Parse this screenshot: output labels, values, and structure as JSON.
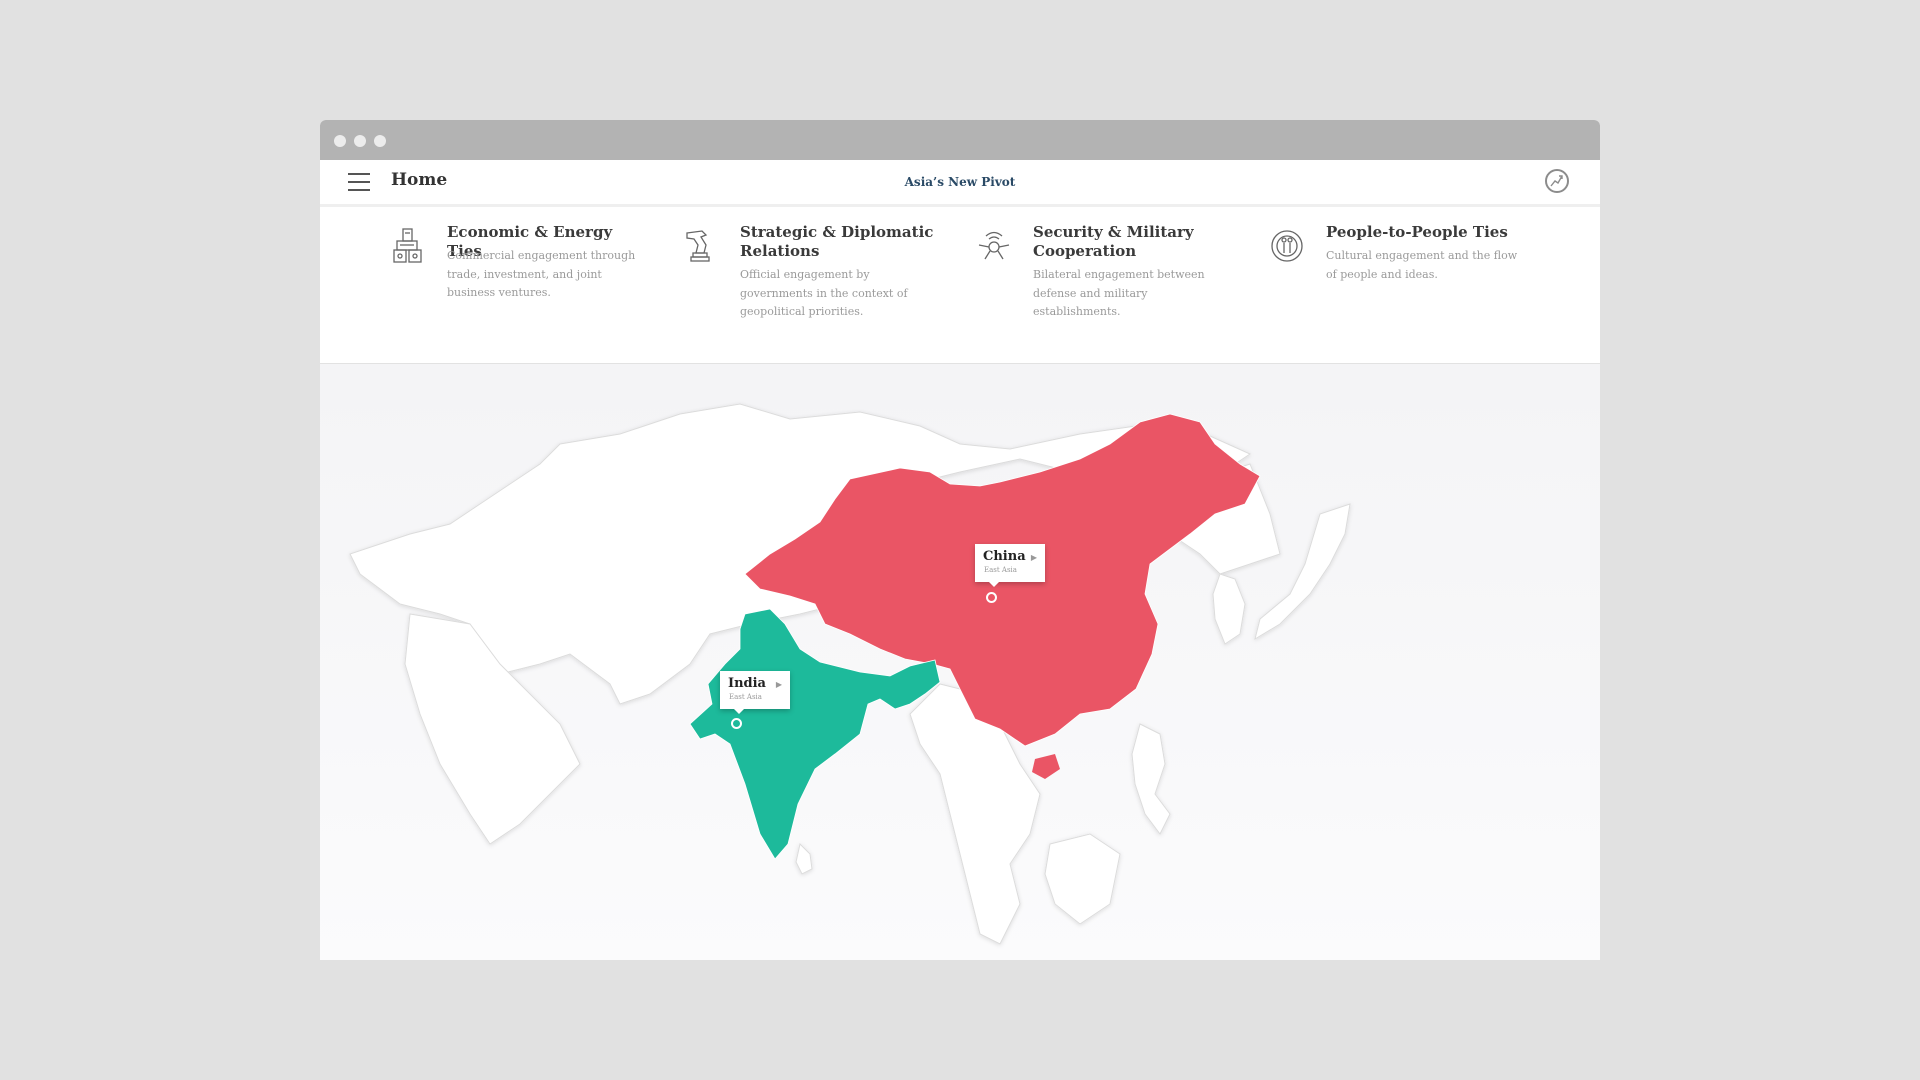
{
  "header": {
    "home_label": "Home",
    "site_title": "Asia’s New Pivot"
  },
  "icons": {
    "menu": "hamburger-menu-icon",
    "logo": "site-logo-icon"
  },
  "categories": [
    {
      "title": "Economic & Energy Ties",
      "description": "Commercial engagement through trade, investment, and joint business ventures.",
      "icon": "buildings-icon"
    },
    {
      "title": "Strategic & Diplomatic Relations",
      "description": "Official engagement by governments in the context of geopolitical priorities.",
      "icon": "chess-knight-icon"
    },
    {
      "title": "Security & Military Cooperation",
      "description": "Bilateral engagement between defense and military establishments.",
      "icon": "satellite-drone-icon"
    },
    {
      "title": "People-to-People Ties",
      "description": "Cultural engagement and the flow of people and ideas.",
      "icon": "people-circle-icon"
    }
  ],
  "map": {
    "countries": [
      {
        "name": "China",
        "region": "East Asia",
        "color": "#ea5565"
      },
      {
        "name": "India",
        "region": "East Asia",
        "color": "#1dba9b"
      }
    ]
  },
  "colors": {
    "china": "#ea5565",
    "india": "#1dba9b",
    "site_title": "#2a4a66",
    "titlebar": "#b3b3b3",
    "background": "#e1e1e1"
  }
}
